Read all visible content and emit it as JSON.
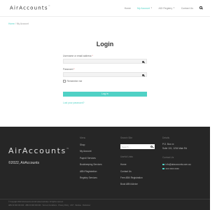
{
  "header": {
    "logo": "AirAccounts",
    "logo_mark": "™",
    "nav": [
      {
        "label": "Home"
      },
      {
        "label": "My Account"
      },
      {
        "label": "ADI Registry"
      },
      {
        "label": "Contact Us"
      }
    ]
  },
  "breadcrumb": {
    "home": "Home",
    "separator": " / ",
    "current": "My Account"
  },
  "login": {
    "title": "Login",
    "username_label": "Username or email address ",
    "password_label": "Password ",
    "required_mark": "*",
    "remember_label": "Remember me",
    "button_label": "Log in",
    "lost_password": "Lost your password?"
  },
  "footer": {
    "logo": "AirAccounts",
    "logo_mark": "™",
    "copyright": "©2022, AirAccounts",
    "menu": {
      "heading": "Menu",
      "items": [
        "Shop",
        "My Account",
        "Payroll Services",
        "Bookkeeping Services",
        "ABN Registration",
        "Registry Services"
      ]
    },
    "search": {
      "heading": "Search Site",
      "placeholder": "Search ..."
    },
    "useful_links": {
      "heading": "Useful Links",
      "items": [
        "Home",
        "Contact Us",
        "Free ABN Registration",
        "Book ABN Advice"
      ]
    },
    "details": {
      "heading": "Details",
      "lines": [
        "P.O. Box xx",
        "Suite 101, 1234 Main Rd"
      ]
    },
    "contact": {
      "heading": "Contact Us",
      "email": "info@airaccounts.com.au",
      "phone": "xxx xxxx xxxx"
    },
    "bottom": [
      "© Copyright 2022 AirAccounts and all related websites. All rights reserved.",
      "ABN 00 000 000 000 · ABN 00 000 000 000 · Terms & Conditions · Privacy Policy · GST · Website · Disclaimer"
    ]
  },
  "colors": {
    "accent": "#4fd1c5",
    "footer_bg": "#262626"
  }
}
